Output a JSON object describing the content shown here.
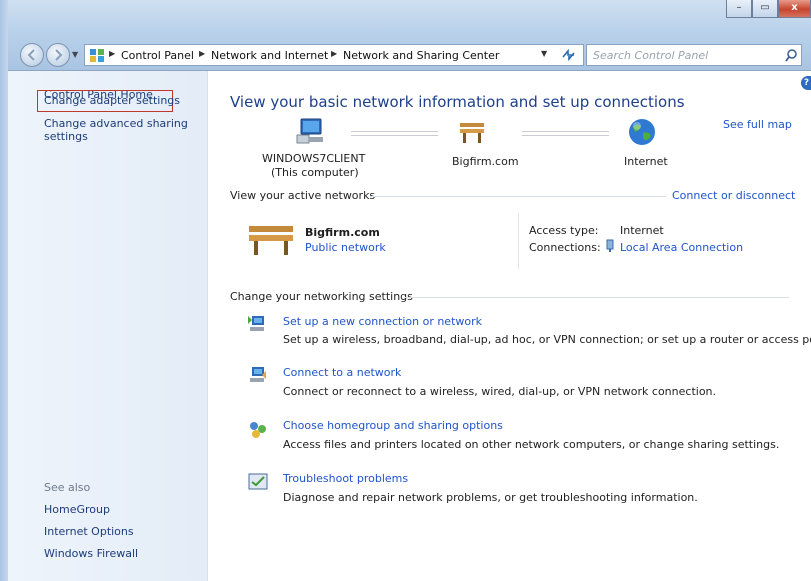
{
  "window": {
    "min_glyph": "–",
    "max_glyph": "▭",
    "close_glyph": "x"
  },
  "address": {
    "crumbs": [
      "Control Panel",
      "Network and Internet",
      "Network and Sharing Center"
    ],
    "search_placeholder": "Search Control Panel"
  },
  "sidebar": {
    "home": "Control Panel Home",
    "items": [
      "Change adapter settings",
      "Change advanced sharing settings"
    ],
    "see_also_label": "See also",
    "see_also": [
      "HomeGroup",
      "Internet Options",
      "Windows Firewall"
    ]
  },
  "main": {
    "title": "View your basic network information and set up connections",
    "see_full_map": "See full map",
    "map": {
      "computer_name": "WINDOWS7CLIENT",
      "computer_sub": "(This computer)",
      "network_name": "Bigfirm.com",
      "internet": "Internet"
    },
    "active_networks_label": "View your active networks",
    "connect_or_disconnect": "Connect or disconnect",
    "active_network": {
      "name": "Bigfirm.com",
      "type": "Public network",
      "access_type_label": "Access type:",
      "access_type_value": "Internet",
      "connections_label": "Connections:",
      "connections_value": "Local Area Connection"
    },
    "change_settings_label": "Change your networking settings",
    "tasks": [
      {
        "title": "Set up a new connection or network",
        "desc": "Set up a wireless, broadband, dial-up, ad hoc, or VPN connection; or set up a router or access point."
      },
      {
        "title": "Connect to a network",
        "desc": "Connect or reconnect to a wireless, wired, dial-up, or VPN network connection."
      },
      {
        "title": "Choose homegroup and sharing options",
        "desc": "Access files and printers located on other network computers, or change sharing settings."
      },
      {
        "title": "Troubleshoot problems",
        "desc": "Diagnose and repair network problems, or get troubleshooting information."
      }
    ]
  }
}
